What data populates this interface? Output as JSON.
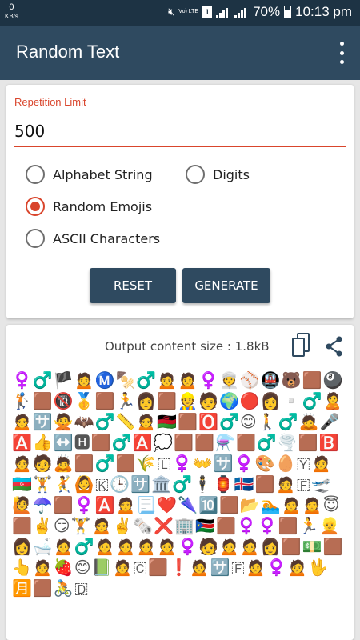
{
  "status": {
    "speed_value": "0",
    "speed_unit": "KB/s",
    "network_label": "Vo) LTE",
    "sim_label": "1",
    "battery_percent": "70%",
    "time": "10:13 pm"
  },
  "app_bar": {
    "title": "Random Text",
    "menu_icon": "overflow-menu-icon"
  },
  "form": {
    "label": "Repetition Limit",
    "value": "500",
    "options": [
      {
        "label": "Alphabet String",
        "checked": false
      },
      {
        "label": "Digits",
        "checked": false
      },
      {
        "label": "Random Emojis",
        "checked": true
      },
      {
        "label": "ASCII Characters",
        "checked": false
      }
    ],
    "reset_label": "RESET",
    "generate_label": "GENERATE"
  },
  "output": {
    "size_label": "Output content size : 1.8kB",
    "copy_icon": "copy-icon",
    "share_icon": "share-icon",
    "content": "♀️♂️🏴🙍Ⓜ️🍢♂️🙍🙍♀️👳⚾🚇🐻🟫🎱🏌️🟫🔞🥇🟫🏃👩🟫👷🧑🌍🔴👩▫️♂️🙎🙍🈂️🙅🦇♂️📏🙍🇲🇼🟫🅾️♂️😊🚶♂️🙇🎤🅰️👍↔️🅷🟫♂️🅰️💭🟫🟫⚗️🟫♂️🌪️🟫🅱️🙍🧑🙇🟫♂️🟫🌾🇱♀️👐🈂️♀️🎨🥚🇾🙍🇦🇿🏋️🤾🙆🇰🕒🈂️🏛️♂️🕴️🏮🇮🇸🟫🙍🇫🛫🙋☂️🟫♀️🅰️🙍📃❤️🌂🔟🟫📂🏊🙍🙍😇🟫✌️😏🏋️🙍✌️🗞️❌🏢🇸🇸🟫♀️♀️🟫🏃👱👩🛁🙍♂️🙍🙍🙍🙍♀️🧑🙍🙍👩🟫💵🟫👆🙍🍓😊📗🙍🇨🟫❗🙍🈂️🇫🙍♀️🙍🖖🈷️🟫🚴🇩"
  }
}
